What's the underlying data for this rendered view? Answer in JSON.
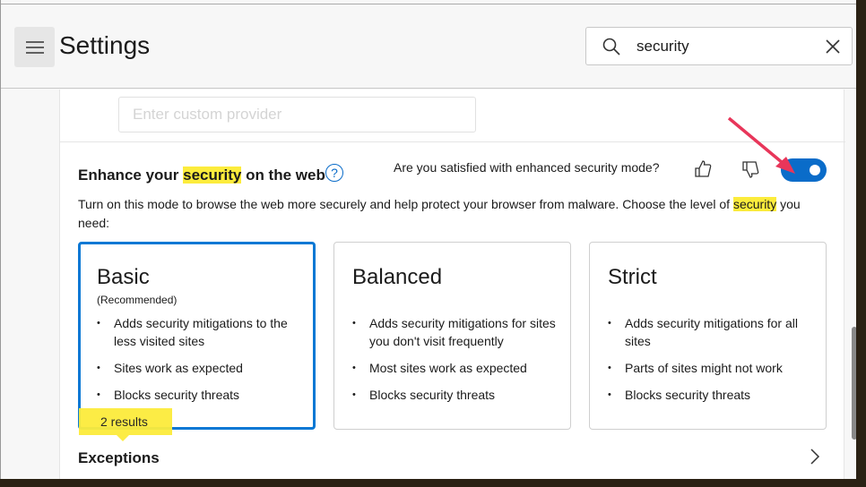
{
  "header": {
    "title": "Settings",
    "search_value": "security",
    "menu_icon": "hamburger-icon",
    "search_icon": "search-icon",
    "clear_icon": "close-icon"
  },
  "provider": {
    "placeholder": "Enter custom provider"
  },
  "section": {
    "title_pre": "Enhance your ",
    "title_highlight": "security",
    "title_post": " on the web",
    "help": "?",
    "feedback_question": "Are you satisfied with enhanced security mode?",
    "toggle_on": true,
    "desc_pre": "Turn on this mode to browse the web more securely and help protect your browser from malware. Choose the level of ",
    "desc_highlight": "security",
    "desc_post": " you need:"
  },
  "options": [
    {
      "title": "Basic",
      "subtitle": "(Recommended)",
      "selected": true,
      "bullets": [
        "Adds security mitigations to the less visited sites",
        "Sites work as expected",
        "Blocks security threats"
      ]
    },
    {
      "title": "Balanced",
      "selected": false,
      "bullets": [
        "Adds security mitigations for sites you don't visit frequently",
        "Most sites work as expected",
        "Blocks security threats"
      ]
    },
    {
      "title": "Strict",
      "selected": false,
      "bullets": [
        "Adds security mitigations for all sites",
        "Parts of sites might not work",
        "Blocks security threats"
      ]
    }
  ],
  "tooltip": "2 results",
  "exceptions": "Exceptions",
  "colors": {
    "accent": "#0a78d4",
    "highlight": "#fcec3c",
    "annotation_arrow": "#e8365a"
  }
}
